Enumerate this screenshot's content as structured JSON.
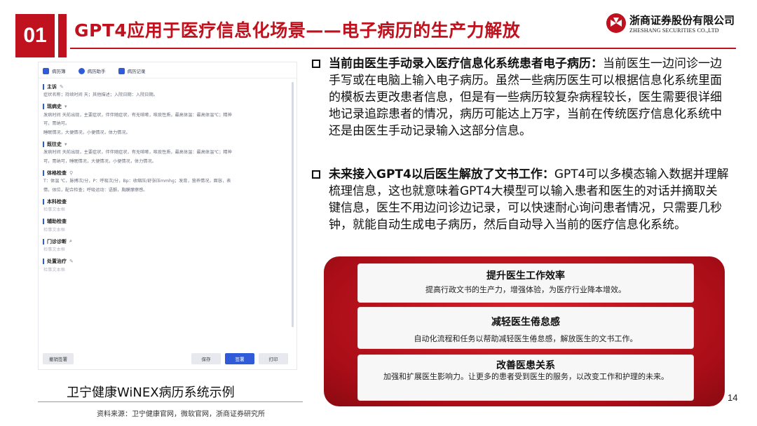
{
  "header": {
    "section_number": "01",
    "title": "GPT4应用于医疗信息化场景——电子病历的生产力解放",
    "logo_cn": "浙商证券股份有限公司",
    "logo_en": "ZHESHANG SECURITIES CO.,LTD",
    "brand_color": "#c0121e"
  },
  "emr": {
    "tabs": [
      {
        "label": "病历簿",
        "icon": "book-icon"
      },
      {
        "label": "病历助手",
        "icon": "assistant-icon"
      },
      {
        "label": "病历记录",
        "icon": "record-icon"
      }
    ],
    "sections": [
      {
        "title": "主诉",
        "icon": "edit-icon",
        "lines": [
          "症状名称；持续时间 天；其他描述；入院日期：入院日期。"
        ]
      },
      {
        "title": "现病史",
        "icon": "dropdown-icon",
        "lines": [
          "发病时间 天前出现，主要症状，伴伴随症状，有无咳嗽，咳痰性质，最高体温：最高体温℃；精神",
          "可，胃纳可。",
          "睡眠情况，大便情况，小便情况，体力情况。"
        ]
      },
      {
        "title": "既往史",
        "icon": "dropdown-icon",
        "lines": [
          "发病时间 天前出现，主要症状，伴伴随症状，有无咳嗽，咳痰性质，最高体温：最高体温℃；精神",
          "可，胃纳可，睡眠情况，大便情况，小便情况，体力情况。"
        ]
      },
      {
        "title": "体格检查",
        "icon": "pin-icon",
        "lines": [
          "T：体温 ℃，脉搏次/分，P：呼吸次/分，Bp：收缩压/舒张压mmhg；发育，营养情况，面容，表",
          "情，体位，配合检查；呼吸运动：语颤，胸膜摩擦感。"
        ]
      },
      {
        "title": "本科检查",
        "icon": "",
        "lines": [
          "检事文本框"
        ]
      },
      {
        "title": "辅助检查",
        "icon": "",
        "lines": [
          "检事文本框"
        ]
      },
      {
        "title": "门诊诊断",
        "icon": "search-icon",
        "lines": [
          "检事文本框"
        ]
      },
      {
        "title": "处置治疗",
        "icon": "edit-icon",
        "lines": [
          "检事文本框"
        ]
      }
    ],
    "buttons": {
      "undo": "撤销签署",
      "save": "保存",
      "submit": "签署",
      "print": "打印"
    }
  },
  "caption": "卫宁健康WiNEX病历系统示例",
  "source": "资料来源：卫宁健康官网，微软官网，浙商证券研究所",
  "bullets": [
    {
      "head": "当前由医生手动录入医疗信息化系统患者电子病历：",
      "body": "当前医生一边问诊一边手写或在电脑上输入电子病历。虽然一些病历医生可以根据信息化系统里面的模板去更改患者信息，但是有一些病历较复杂病程较长，医生需要很详细地记录追踪患者的情况，病历可能达上万字，当前在传统医疗信息化系统中还是由医生手动记录输入这部分信息。"
    },
    {
      "head": "未来接入GPT4以后医生解放了文书工作：",
      "body": "GPT4可以多模态输入数据并理解梳理信息，这也就意味着GPT4大模型可以输入患者和医生的对话并摘取关键信息，医生不用边问诊边记录，可以快速耐心询问患者情况，只需要几秒钟，就能自动生成电子病历，然后自动导入当前的医疗信息化系统。"
    }
  ],
  "cards": [
    {
      "title": "提升医生工作效率",
      "desc": "提高行政文书的生产力，增强体验，为医疗行业降本增效。"
    },
    {
      "title": "减轻医生倦怠感",
      "desc": "自动化流程和任务以帮助减轻医生倦怠感，解放医生的文书工作。"
    },
    {
      "title": "改善医患关系",
      "desc": "加强和扩展医生影响力。让更多的患者受到医生的服务，以改变工作和护理的未来。"
    }
  ],
  "page_number": "14"
}
